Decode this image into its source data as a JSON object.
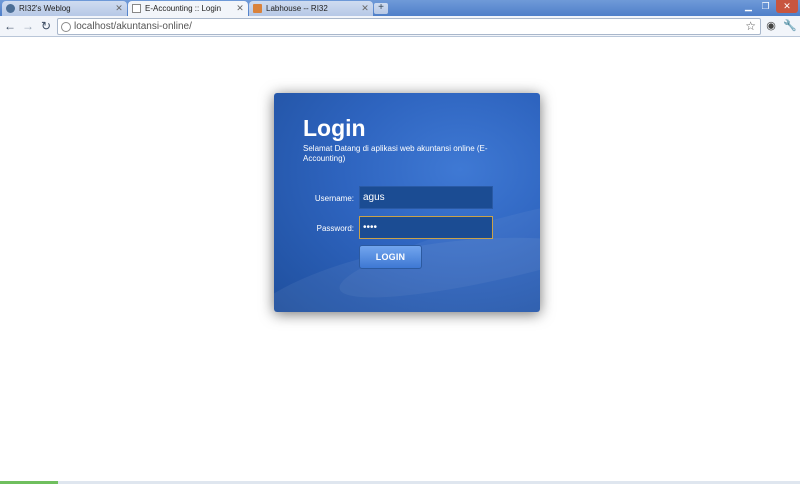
{
  "browser": {
    "tabs": [
      {
        "title": "RI32's Weblog",
        "active": false
      },
      {
        "title": "E-Accounting :: Login",
        "active": true
      },
      {
        "title": "Labhouse -- RI32",
        "active": false
      }
    ],
    "new_tab_label": "+",
    "address": "localhost/akuntansi-online/",
    "icons": [
      "back-arrow-icon",
      "forward-arrow-icon",
      "reload-icon",
      "star-icon",
      "page-menu-icon",
      "wrench-icon",
      "minimize-icon",
      "restore-icon",
      "close-icon"
    ],
    "accent_color": "#5a88d0"
  },
  "login": {
    "title": "Login",
    "subtitle": "Selamat Datang di aplikasi web akuntansi online (E-Accounting)",
    "username_label": "Username:",
    "username_value": "agus",
    "password_label": "Password:",
    "password_value": "agus",
    "button_label": "LOGIN",
    "panel_color": "#2e64bf"
  }
}
